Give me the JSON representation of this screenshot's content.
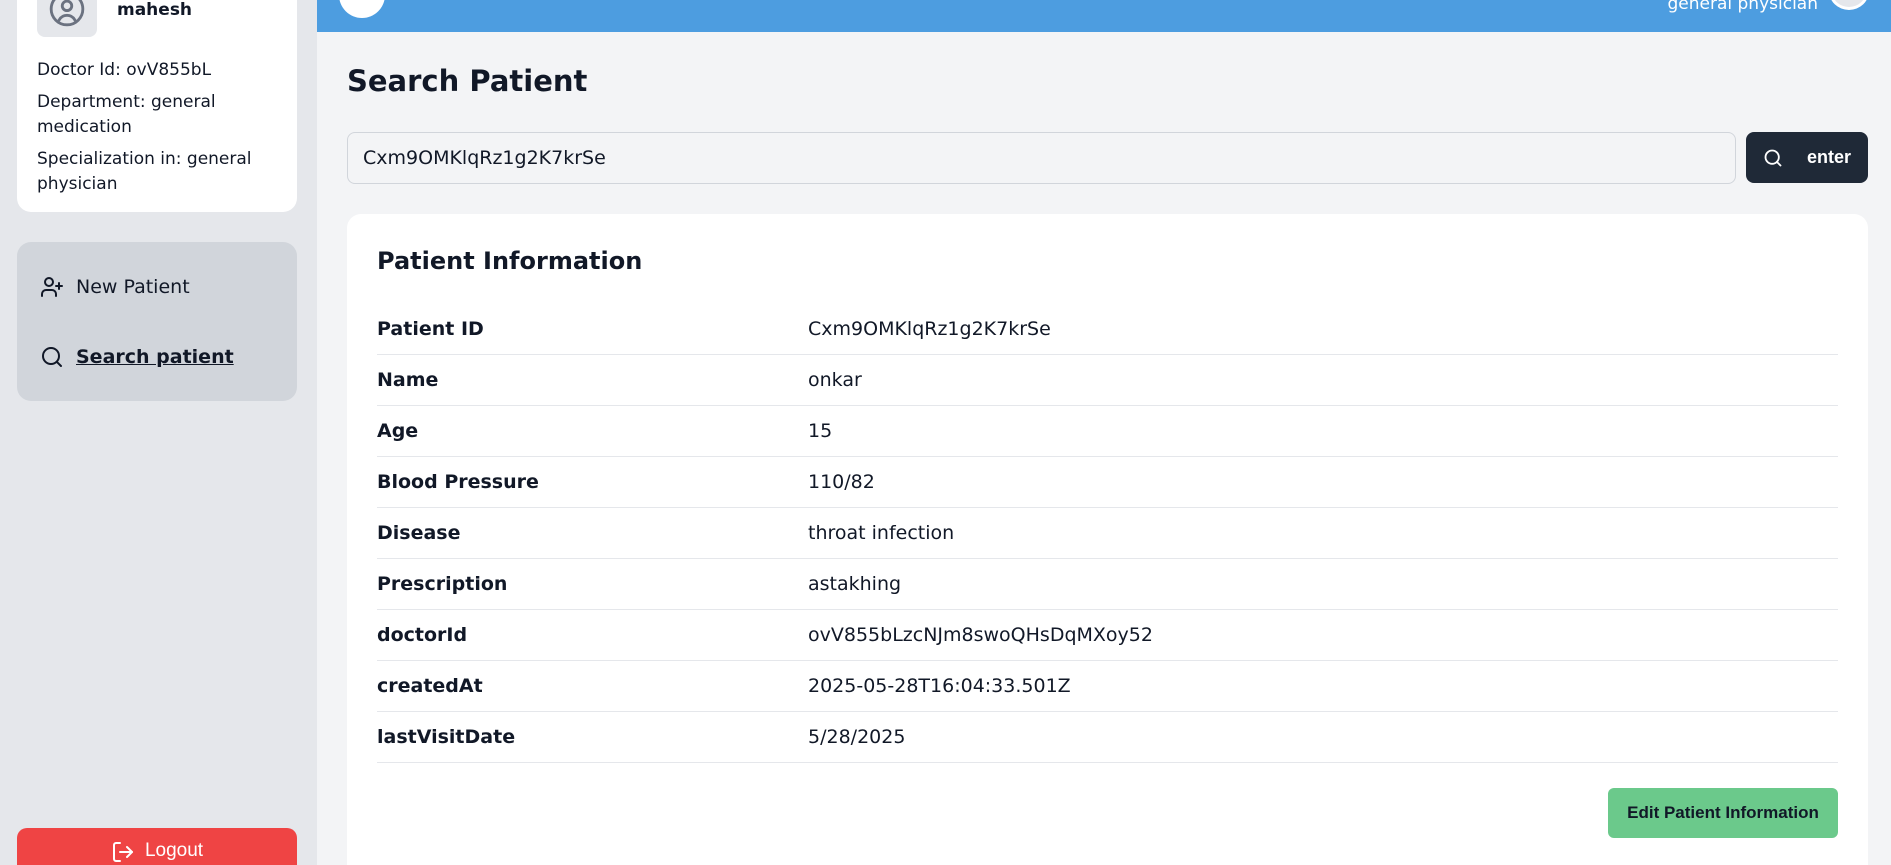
{
  "sidebar": {
    "doctor_name": "mahesh",
    "doctor_id": "Doctor Id: ovV855bL",
    "department": "Department: general medication",
    "specialization": "Specialization in: general physician",
    "nav": [
      {
        "label": "New Patient",
        "icon": "user-plus-icon"
      },
      {
        "label": "Search patient",
        "icon": "search-icon",
        "active": true
      }
    ],
    "logout_label": "Logout"
  },
  "header": {
    "role": "general physician"
  },
  "main": {
    "title": "Search Patient",
    "search": {
      "value": "Cxm9OMKlqRz1g2K7krSe",
      "button_label": "enter"
    },
    "card_title": "Patient Information",
    "rows": [
      {
        "label": "Patient ID",
        "value": "Cxm9OMKlqRz1g2K7krSe"
      },
      {
        "label": "Name",
        "value": "onkar"
      },
      {
        "label": "Age",
        "value": "15"
      },
      {
        "label": "Blood Pressure",
        "value": "110/82"
      },
      {
        "label": "Disease",
        "value": "throat infection"
      },
      {
        "label": "Prescription",
        "value": "astakhing"
      },
      {
        "label": "doctorId",
        "value": "ovV855bLzcNJm8swoQHsDqMXoy52"
      },
      {
        "label": "createdAt",
        "value": "2025-05-28T16:04:33.501Z"
      },
      {
        "label": "lastVisitDate",
        "value": "5/28/2025"
      }
    ],
    "edit_label": "Edit Patient Information"
  },
  "colors": {
    "header": "#4d9de0",
    "logout": "#ef4444",
    "edit": "#6bc98b",
    "search_button": "#1f2937"
  }
}
